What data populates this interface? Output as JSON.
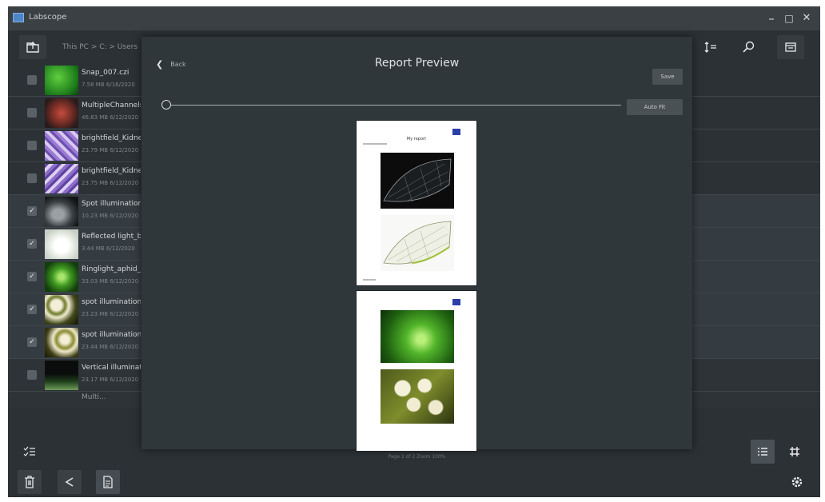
{
  "window": {
    "app_name": "Labscope",
    "minimize": "–",
    "maximize": "□",
    "close": "✕"
  },
  "toolbar": {
    "path": "This PC  >  C:  >  Users",
    "search_close": "✕"
  },
  "files": [
    {
      "name": "Snap_007.czi",
      "meta": "7.58 MB  6/16/2020",
      "selected": false
    },
    {
      "name": "MultipleChannels",
      "meta": "46.83 MB  6/12/2020",
      "selected": false
    },
    {
      "name": "brightfield_Kidney",
      "meta": "23.79 MB  6/12/2020",
      "selected": false
    },
    {
      "name": "brightfield_Kidney",
      "meta": "23.75 MB  6/12/2020",
      "selected": false
    },
    {
      "name": "Spot illumination",
      "meta": "10.23 MB  6/12/2020",
      "selected": true
    },
    {
      "name": "Reflected light_bo",
      "meta": "3.44 MB  6/12/2020",
      "selected": true
    },
    {
      "name": "Ringlight_aphid_S",
      "meta": "33.03 MB  6/12/2020",
      "selected": true
    },
    {
      "name": "spot illumination",
      "meta": "23.23 MB  6/12/2020",
      "selected": true
    },
    {
      "name": "spot illumination",
      "meta": "23.44 MB  6/12/2020",
      "selected": true
    },
    {
      "name": "Vertical illuminati",
      "meta": "23.17 MB  6/12/2020",
      "selected": false
    },
    {
      "name": "Multi...",
      "meta": "",
      "selected": false
    }
  ],
  "modal": {
    "back_label": "Back",
    "title": "Report Preview",
    "save_label": "Save",
    "autofit_label": "Auto Fit",
    "page1_title": "My report",
    "page_footer": "Page 1 of 2  Zoom 100%"
  },
  "colors": {
    "background": "#2b3135",
    "titlebar": "#3a4044",
    "modal": "#30373b",
    "selected_row": "#353c41",
    "brand_blue": "#2c3ea8"
  },
  "icons": {
    "folder_up": "folder-up-icon",
    "sort": "sort-icon",
    "search_image": "search-image-icon",
    "gallery": "gallery-icon",
    "multi_select": "multi-select-icon",
    "list_view": "list-view-icon",
    "grid_view": "grid-view-icon",
    "delete": "trash-icon",
    "share": "share-icon",
    "report": "report-icon",
    "settings": "gear-icon"
  }
}
